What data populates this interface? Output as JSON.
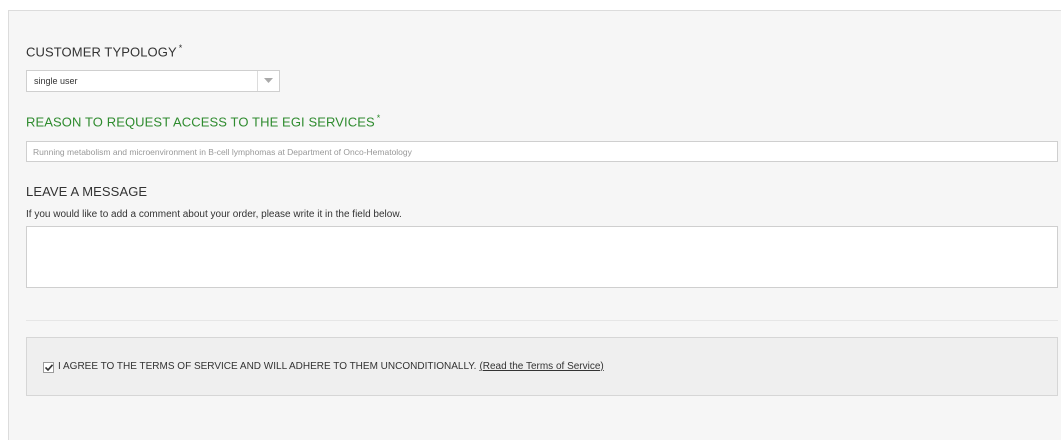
{
  "customer_typology": {
    "label": "CUSTOMER TYPOLOGY",
    "required_mark": "*",
    "selected_value": "single user"
  },
  "reason": {
    "label": "REASON TO REQUEST ACCESS TO THE EGI SERVICES",
    "required_mark": "*",
    "value": "Running metabolism and microenvironment in B-cell lymphomas at Department of Onco-Hematology",
    "label_color": "#2e8b2e"
  },
  "message": {
    "label": "LEAVE A MESSAGE",
    "help_text": "If you would like to add a comment about your order, please write it in the field below.",
    "value": ""
  },
  "terms": {
    "checked": true,
    "text": "I AGREE TO THE TERMS OF SERVICE AND WILL ADHERE TO THEM UNCONDITIONALLY.",
    "link_text": "(Read the Terms of Service)"
  },
  "icons": {
    "select_arrow": "chevron-down-icon",
    "checkbox_check": "checkmark-icon"
  }
}
